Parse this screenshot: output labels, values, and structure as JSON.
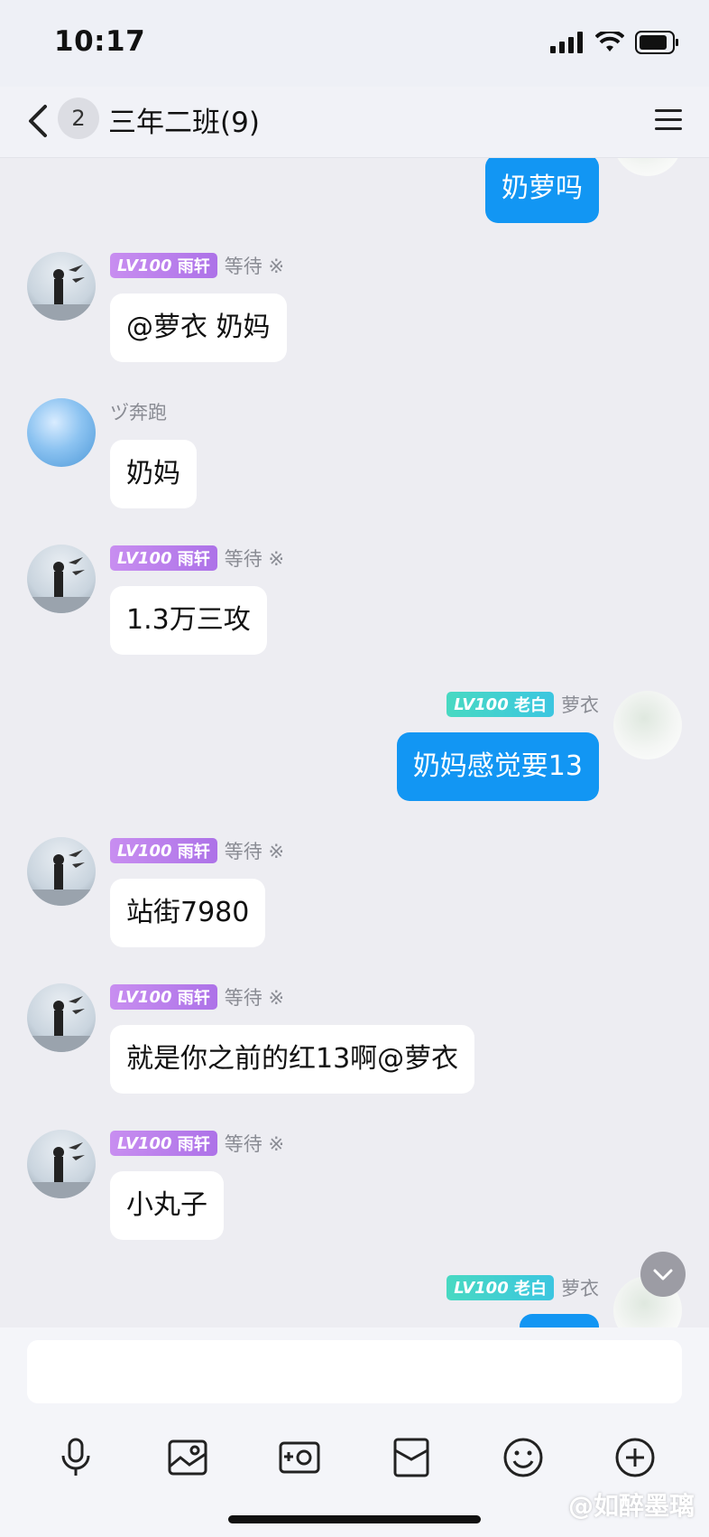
{
  "status": {
    "time": "10:17"
  },
  "header": {
    "unread_count": "2",
    "title": "三年二班(9)"
  },
  "messages": {
    "m0": {
      "text": "奶萝吗"
    },
    "m1": {
      "level": "LV100",
      "title": "雨轩",
      "name": "等待 ※",
      "text": "@萝衣 奶妈"
    },
    "m2": {
      "name": "ヅ奔跑",
      "text": "奶妈"
    },
    "m3": {
      "level": "LV100",
      "title": "雨轩",
      "name": "等待 ※",
      "text": "1.3万三攻"
    },
    "m4": {
      "level": "LV100",
      "title": "老白",
      "name": "萝衣",
      "text": "奶妈感觉要13"
    },
    "m5": {
      "level": "LV100",
      "title": "雨轩",
      "name": "等待 ※",
      "text": "站街7980"
    },
    "m6": {
      "level": "LV100",
      "title": "雨轩",
      "name": "等待 ※",
      "text": "就是你之前的红13啊@萝衣"
    },
    "m7": {
      "level": "LV100",
      "title": "雨轩",
      "name": "等待 ※",
      "text": "小丸子"
    },
    "m8": {
      "level": "LV100",
      "title": "老白",
      "name": "萝衣"
    }
  },
  "toolbar": {
    "icons": [
      "microphone-icon",
      "photo-icon",
      "camera-icon",
      "red-packet-icon",
      "emoji-icon",
      "plus-icon"
    ]
  },
  "watermark": "@如醉墨璃",
  "colors": {
    "bubble_right": "#1296f3",
    "level_purple": "#b57cea",
    "level_green": "#40cfd0",
    "background": "#ededf2"
  }
}
